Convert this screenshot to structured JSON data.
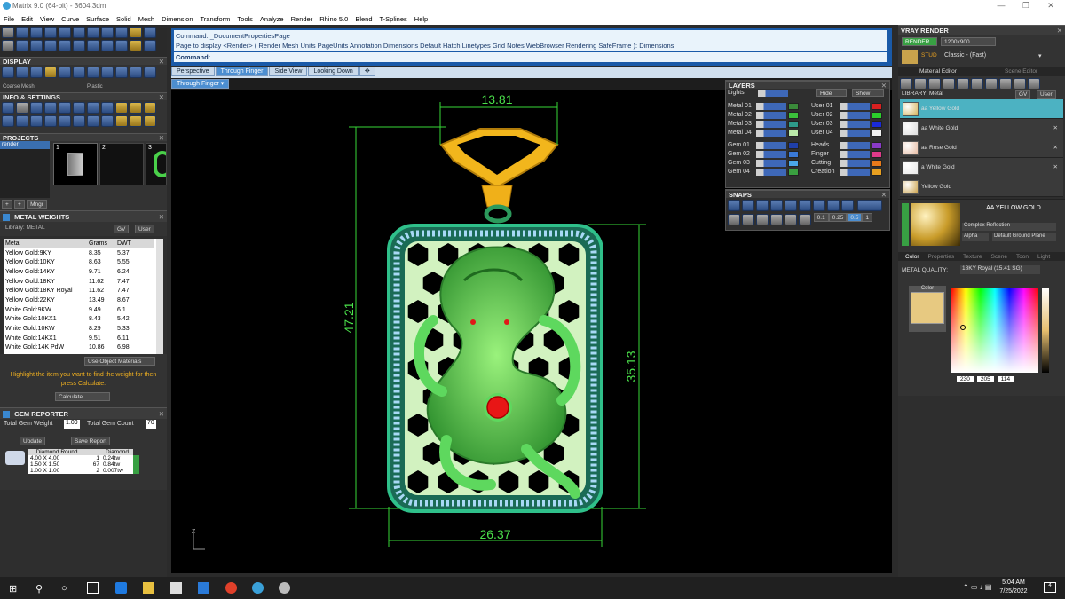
{
  "window": {
    "title": "Matrix 9.0 (64-bit) - 3604.3dm",
    "min": "—",
    "max": "❐",
    "close": "✕"
  },
  "menu": [
    "File",
    "Edit",
    "View",
    "Curve",
    "Surface",
    "Solid",
    "Mesh",
    "Dimension",
    "Transform",
    "Tools",
    "Analyze",
    "Render",
    "Rhino 5.0",
    "Blend",
    "T-Splines",
    "Help"
  ],
  "left": {
    "display_header": "DISPLAY",
    "display_mode": "Coarse Mesh",
    "display_mode2": "Plastic",
    "info_header": "INFO & SETTINGS",
    "projects_header": "PROJECTS",
    "projects_item": "render",
    "projects_thumbs": [
      "1",
      "2",
      "3"
    ],
    "projects_mngr": "Mngr",
    "metal_header": "METAL WEIGHTS",
    "metal_library": "Library: METAL",
    "metal_lib_btn1": "GV",
    "metal_lib_btn2": "User",
    "metal_columns": [
      "Metal",
      "Grams",
      "DWT"
    ],
    "metal_rows": [
      [
        "Yellow Gold:9KY",
        "8.35",
        "5.37"
      ],
      [
        "Yellow Gold:10KY",
        "8.63",
        "5.55"
      ],
      [
        "Yellow Gold:14KY",
        "9.71",
        "6.24"
      ],
      [
        "Yellow Gold:18KY",
        "11.62",
        "7.47"
      ],
      [
        "Yellow Gold:18KY Royal",
        "11.62",
        "7.47"
      ],
      [
        "Yellow Gold:22KY",
        "13.49",
        "8.67"
      ],
      [
        "White Gold:9KW",
        "9.49",
        "6.1"
      ],
      [
        "White Gold:10KX1",
        "8.43",
        "5.42"
      ],
      [
        "White Gold:10KW",
        "8.29",
        "5.33"
      ],
      [
        "White Gold:14KX1",
        "9.51",
        "6.11"
      ],
      [
        "White Gold:14K PdW",
        "10.86",
        "6.98"
      ]
    ],
    "use_object_materials": "Use Object Materials",
    "metal_hint": "Highlight the item you want to find the weight for then press Calculate.",
    "calculate": "Calculate",
    "gem_header": "GEM REPORTER",
    "total_gem_weight_label": "Total Gem Weight",
    "total_gem_weight": "1.09",
    "total_gem_count_label": "Total Gem Count",
    "total_gem_count": "70",
    "update": "Update",
    "save_report": "Save Report",
    "gem_columns": [
      "Diamond Round",
      "",
      "Diamond"
    ],
    "gem_rows": [
      [
        "4.00 X 4.00",
        "1",
        "0.24tw"
      ],
      [
        "1.50 X 1.50",
        "67",
        "0.84tw"
      ],
      [
        "1.00 X 1.00",
        "2",
        "0.007tw"
      ]
    ]
  },
  "command": {
    "history_line1": "Command: _DocumentPropertiesPage",
    "history_line2": "Page to display <Render> ( Render  Mesh  Units  PageUnits  Annotation  Dimensions  Default  Hatch  Linetypes  Grid  Notes  WebBrowser  Rendering  SafeFrame ): Dimensions",
    "prompt": "Command:"
  },
  "view_tabs": [
    "Perspective",
    "Through Finger",
    "Side View",
    "Looking Down"
  ],
  "view_tab_add": "✥",
  "viewport_label": "Through Finger",
  "dimensions": {
    "top": "13.81",
    "left": "47.21",
    "right": "35.13",
    "bottom": "26.37"
  },
  "axis_label": "Z",
  "layers": {
    "header": "LAYERS",
    "lights": "Lights",
    "hide": "Hide",
    "show": "Show",
    "left_rows": [
      {
        "name": "Metal 01",
        "color": "#3a8a3a"
      },
      {
        "name": "Metal 02",
        "color": "#3bbf3b"
      },
      {
        "name": "Metal 03",
        "color": "#2e9a8a"
      },
      {
        "name": "Metal 04",
        "color": "#b9e8a8"
      },
      {
        "name": "Gem 01",
        "color": "#1f3fa8"
      },
      {
        "name": "Gem 02",
        "color": "#3a7ad8"
      },
      {
        "name": "Gem 03",
        "color": "#4aa8e8"
      },
      {
        "name": "Gem 04",
        "color": "#3aa040"
      }
    ],
    "right_rows": [
      {
        "name": "User 01",
        "color": "#d82020"
      },
      {
        "name": "User 02",
        "color": "#2bcf2b"
      },
      {
        "name": "User 03",
        "color": "#1a2ad8"
      },
      {
        "name": "User 04",
        "color": "#f0f0f0"
      },
      {
        "name": "Heads",
        "color": "#8a3ac8"
      },
      {
        "name": "Finger",
        "color": "#e03a8a"
      },
      {
        "name": "Cutting",
        "color": "#e87a1a"
      },
      {
        "name": "Creation",
        "color": "#e8a020"
      }
    ]
  },
  "snaps": {
    "header": "SNAPS",
    "vals": [
      "0.1",
      "0.25",
      "0.5",
      "1"
    ]
  },
  "vray": {
    "header": "VRAY RENDER",
    "render_btn": "RENDER",
    "resolution": "1200x900",
    "preset": "Classic - (Fast)",
    "preset_tag": "STUD",
    "tab_material_editor": "Material Editor",
    "tab_scene_editor": "Scene Editor",
    "library_label": "LIBRARY: Metal",
    "lib_btn1": "GV",
    "lib_btn2": "User",
    "materials": [
      "aa Yellow Gold",
      "aa White Gold",
      "aa Rose Gold",
      "a White Gold",
      "Yellow Gold"
    ],
    "selected_material_name": "AA YELLOW GOLD",
    "reflection": "Complex Reflection",
    "alpha": "Alpha",
    "ground": "Default Ground Plane",
    "prop_tabs": [
      "Color",
      "Properties",
      "Texture",
      "Scene",
      "Toon",
      "Light"
    ],
    "metal_quality_label": "METAL QUALITY:",
    "metal_quality_value": "18KY Royal (15.41 SG)",
    "color_label": "Color",
    "swatch_color": "#e7c981",
    "rgb": [
      "230",
      "205",
      "114"
    ]
  },
  "taskbar": {
    "time": "5:04 AM",
    "date": "7/25/2022",
    "notif": "4"
  }
}
